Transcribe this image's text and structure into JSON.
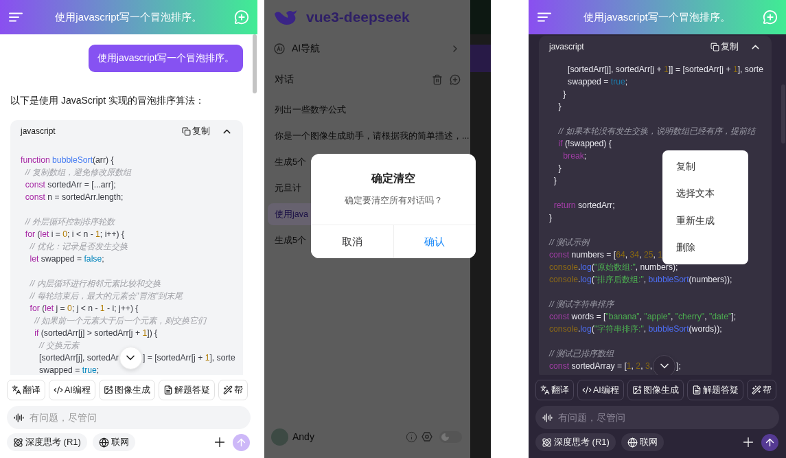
{
  "screens": [
    {
      "kind": "chat",
      "dark_theme": false,
      "title": "使用javascript写一个冒泡排序。",
      "user_message": "使用javascript写一个冒泡排序。",
      "intro": "以下是使用 JavaScript 实现的冒泡排序算法：",
      "code": {
        "language": "javascript",
        "copy_label": "复制",
        "paragraphs": [
          [
            [
              {
                "kind": "kw",
                "text": "function "
              },
              {
                "kind": "fn",
                "text": "bubbleSort"
              },
              "(arr) {"
            ],
            [
              {
                "kind": "com",
                "text": "  // 复制数组，避免修改原数组"
              }
            ],
            [
              {
                "kind": "kw",
                "text": "  const"
              },
              " sortedArr = [...arr];"
            ],
            [
              {
                "kind": "kw",
                "text": "  const"
              },
              " n = sortedArr.length;"
            ]
          ],
          [
            [
              {
                "kind": "com",
                "text": "  // 外层循环控制排序轮数"
              }
            ],
            [
              {
                "kind": "kw",
                "text": "  for"
              },
              " (",
              {
                "kind": "kw",
                "text": "let"
              },
              " i = ",
              {
                "kind": "num",
                "text": "0"
              },
              "; i < n - ",
              {
                "kind": "num",
                "text": "1"
              },
              "; i++) {"
            ],
            [
              {
                "kind": "com",
                "text": "    // 优化：记录是否发生交换"
              }
            ],
            [
              {
                "kind": "kw",
                "text": "    let"
              },
              " swapped = ",
              {
                "kind": "lit",
                "text": "false"
              },
              ";"
            ]
          ],
          [
            [
              {
                "kind": "com",
                "text": "    // 内层循环进行相邻元素比较和交换"
              }
            ],
            [
              {
                "kind": "com",
                "text": "    // 每轮结束后，最大的元素会\"冒泡\"到末尾"
              }
            ],
            [
              {
                "kind": "kw",
                "text": "    for"
              },
              " (",
              {
                "kind": "kw",
                "text": "let"
              },
              " j = ",
              {
                "kind": "num",
                "text": "0"
              },
              "; j < n - ",
              {
                "kind": "num",
                "text": "1"
              },
              " - i; j++) {"
            ],
            [
              {
                "kind": "com",
                "text": "      // 如果前一个元素大于后一个元素，则交换它们"
              }
            ],
            [
              {
                "kind": "kw",
                "text": "      if"
              },
              " (sortedArr[j] > sortedArr[j + ",
              {
                "kind": "num",
                "text": "1"
              },
              "]) {"
            ],
            [
              {
                "kind": "com",
                "text": "        // 交换元素"
              }
            ],
            {
              "parts": [
                [
                  "        [sortedArr[j], sortedAr"
                ],
                [
                  "] = [sortedArr[j + ",
                  {
                    "kind": "num",
                    "text": "1"
                  },
                  "], sorte"
                ]
              ]
            },
            [
              "        swapped = ",
              {
                "kind": "lit",
                "text": "true"
              },
              ";"
            ]
          ]
        ]
      },
      "quick_actions": [
        "翻译",
        "AI编程",
        "图像生成",
        "解题答疑",
        "帮"
      ],
      "input": {
        "placeholder": "有问题，尽管问"
      },
      "options": [
        "深度思考 (R1)",
        "联网"
      ],
      "send_disabled": true
    },
    {
      "kind": "sidebar",
      "app_name": "vue3-deepseek",
      "nav": {
        "label": "AI导航"
      },
      "section": "对话",
      "conversations": [
        {
          "title": "列出一些数学公式",
          "selected": false
        },
        {
          "title": "你是一个图像生成助手，请根据我的简单描述，...",
          "selected": false
        },
        {
          "title": "生成5个",
          "selected": false
        },
        {
          "title": "元旦计",
          "selected": false
        },
        {
          "title": "使用java",
          "selected": true
        },
        {
          "title": "生成5个",
          "selected": false
        }
      ],
      "user": {
        "name": "Andy"
      },
      "dark_mode": false,
      "dialog": {
        "title": "确定清空",
        "message": "确定要清空所有对话吗？",
        "buttons": [
          {
            "label": "取消",
            "primary": false
          },
          {
            "label": "确认",
            "primary": true
          }
        ]
      }
    },
    {
      "kind": "chat",
      "dark_theme": true,
      "title": "使用javascript写一个冒泡排序。",
      "code": {
        "language": "javascript",
        "copy_label": "复制",
        "paragraphs": [
          [
            [
              "        [sortedArr[j], sortedArr[j + ",
              {
                "kind": "num",
                "text": "1"
              },
              "]] = [sortedArr[j + ",
              {
                "kind": "num",
                "text": "1"
              },
              "], sorte"
            ],
            [
              "        swapped = ",
              {
                "kind": "lit",
                "text": "true"
              },
              ";"
            ],
            [
              "      }"
            ],
            [
              "    }"
            ]
          ],
          [
            [
              {
                "kind": "com",
                "text": "    // 如果本轮没有发生交换，说明数组已经有序，提前结"
              }
            ],
            [
              {
                "kind": "kw",
                "text": "    if"
              },
              " (!swapped) {"
            ],
            [
              {
                "kind": "kw",
                "text": "      break"
              },
              ";"
            ],
            [
              "    }"
            ],
            [
              "  }"
            ]
          ],
          [
            [
              {
                "kind": "kw",
                "text": "  return"
              },
              " sortedArr;"
            ],
            [
              "}"
            ]
          ],
          [
            [
              {
                "kind": "com",
                "text": "// 测试示例"
              }
            ],
            [
              {
                "kind": "kw",
                "text": "const"
              },
              " numbers = [",
              {
                "kind": "num",
                "text": "64"
              },
              ", ",
              {
                "kind": "num",
                "text": "34"
              },
              ", ",
              {
                "kind": "num",
                "text": "25"
              },
              ", ",
              {
                "kind": "num",
                "text": "1"
              }
            ],
            [
              {
                "kind": "obj",
                "text": "console"
              },
              ".",
              {
                "kind": "fn",
                "text": "log"
              },
              "(",
              {
                "kind": "str",
                "text": "\"原始数组:\""
              },
              ", numbers);"
            ],
            [
              {
                "kind": "obj",
                "text": "console"
              },
              ".",
              {
                "kind": "fn",
                "text": "log"
              },
              "(",
              {
                "kind": "str",
                "text": "\"排序后数组:\""
              },
              ", ",
              {
                "kind": "fn",
                "text": "bubbleSort"
              },
              "(numbers));"
            ]
          ],
          [
            [
              {
                "kind": "com",
                "text": "// 测试字符串排序"
              }
            ],
            [
              {
                "kind": "kw",
                "text": "const"
              },
              " words = [",
              {
                "kind": "str",
                "text": "\"banana\""
              },
              ", ",
              {
                "kind": "str",
                "text": "\"apple\""
              },
              ", ",
              {
                "kind": "str",
                "text": "\"cherry\""
              },
              ", ",
              {
                "kind": "str",
                "text": "\"date\""
              },
              "];"
            ],
            [
              {
                "kind": "obj",
                "text": "console"
              },
              ".",
              {
                "kind": "fn",
                "text": "log"
              },
              "(",
              {
                "kind": "str",
                "text": "\"字符串排序:\""
              },
              ", ",
              {
                "kind": "fn",
                "text": "bubbleSort"
              },
              "(words));"
            ]
          ],
          [
            [
              {
                "kind": "com",
                "text": "// 测试已排序数组"
              }
            ],
            {
              "parts": [
                [
                  {
                    "kind": "kw",
                    "text": "const"
                  },
                  " sortedArray = [",
                  {
                    "kind": "num",
                    "text": "1"
                  },
                  ", ",
                  {
                    "kind": "num",
                    "text": "2"
                  },
                  ", ",
                  {
                    "kind": "num",
                    "text": "3"
                  },
                  ","
                ],
                [
                  "];"
                ]
              ]
            }
          ]
        ]
      },
      "context_menu": [
        "复制",
        "选择文本",
        "重新生成",
        "删除"
      ],
      "quick_actions": [
        "翻译",
        "AI编程",
        "图像生成",
        "解题答疑",
        "帮"
      ],
      "input": {
        "placeholder": "有问题，尽管问"
      },
      "options": [
        "深度思考 (R1)",
        "联网"
      ],
      "send_disabled": true
    }
  ]
}
